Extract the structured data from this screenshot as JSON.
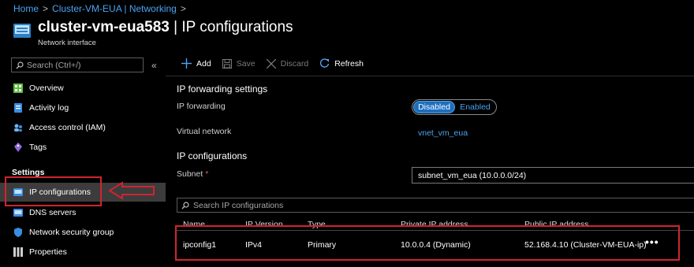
{
  "breadcrumb": {
    "home": "Home",
    "parent": "Cluster-VM-EUA | Networking",
    "sep1": ">",
    "sep2": ">"
  },
  "header": {
    "resource": "cluster-vm-eua583",
    "separator": " | ",
    "page": "IP configurations",
    "subtitle": "Network interface",
    "icon": "network-interface-icon"
  },
  "sidebar": {
    "search_placeholder": "Search (Ctrl+/)",
    "collapse": "«",
    "items": [
      {
        "label": "Overview",
        "icon": "overview-icon"
      },
      {
        "label": "Activity log",
        "icon": "activity-log-icon"
      },
      {
        "label": "Access control (IAM)",
        "icon": "iam-icon"
      },
      {
        "label": "Tags",
        "icon": "tag-icon"
      }
    ],
    "settings_label": "Settings",
    "settings_items": [
      {
        "label": "IP configurations",
        "icon": "ip-config-icon",
        "active": true
      },
      {
        "label": "DNS servers",
        "icon": "dns-icon"
      },
      {
        "label": "Network security group",
        "icon": "shield-icon"
      },
      {
        "label": "Properties",
        "icon": "properties-icon"
      }
    ]
  },
  "toolbar": {
    "add": "Add",
    "save": "Save",
    "discard": "Discard",
    "refresh": "Refresh"
  },
  "forwarding": {
    "section_title": "IP forwarding settings",
    "label": "IP forwarding",
    "options": [
      "Disabled",
      "Enabled"
    ],
    "selected": "Disabled",
    "vnet_label": "Virtual network",
    "vnet_value": "vnet_vm_eua"
  },
  "ipconfigs": {
    "section_title": "IP configurations",
    "subnet_label": "Subnet",
    "required_mark": "*",
    "subnet_value": "subnet_vm_eua (10.0.0.0/24)",
    "search_placeholder": "Search IP configurations",
    "columns": [
      "Name",
      "IP Version",
      "Type",
      "Private IP address",
      "Public IP address"
    ],
    "rows": [
      [
        "ipconfig1",
        "IPv4",
        "Primary",
        "10.0.0.4 (Dynamic)",
        "52.168.4.10 (Cluster-VM-EUA-ip)"
      ]
    ],
    "row_menu": "•••"
  },
  "colors": {
    "accent": "#4aa3f3",
    "highlight": "#d0242f",
    "toggle_on": "#1d6fbf"
  }
}
